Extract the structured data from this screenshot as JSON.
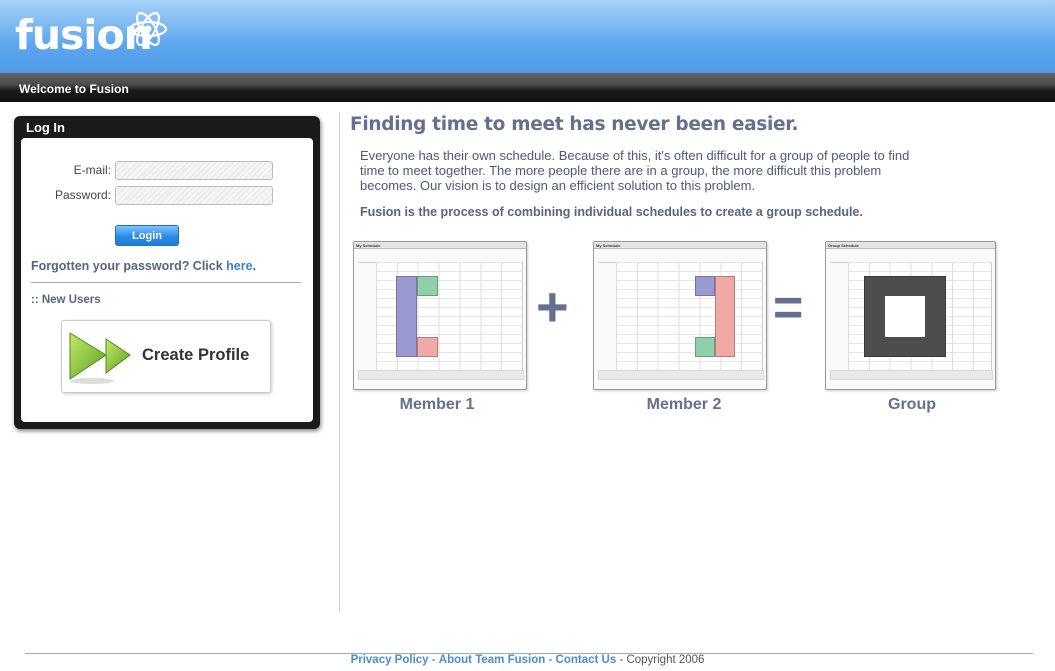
{
  "header": {
    "logo_text": "fusion",
    "welcome": "Welcome to Fusion"
  },
  "login": {
    "title": "Log In",
    "email_label": "E-mail:",
    "password_label": "Password:",
    "email_value": "",
    "password_value": "",
    "login_button": "Login",
    "forgot_prefix": "Forgotten your password? Click ",
    "forgot_link": "here",
    "forgot_suffix": ".",
    "new_users": ":: New Users",
    "create_profile": "Create Profile"
  },
  "main": {
    "headline": "Finding time to meet has never been easier.",
    "intro": "Everyone has their own schedule. Because of this, it's often difficult for a group of people to find time to meet together. The more people there are in a group, the more difficult this problem becomes. Our vision is to design an efficient solution to this problem.",
    "tagline": "Fusion is the process of combining individual schedules to create a group schedule.",
    "plus": "+",
    "equals": "=",
    "calendars": [
      {
        "title": "My Schedule",
        "caption": "Member 1"
      },
      {
        "title": "My Schedule",
        "caption": "Member 2"
      },
      {
        "title": "Group Schedule",
        "caption": "Group"
      }
    ]
  },
  "colors": {
    "busy_purple": "#9b9ad0",
    "busy_green": "#8fd0a8",
    "busy_red": "#f0a9a6",
    "group_busy": "#4d4d4d",
    "accent": "#656f8f"
  },
  "footer": {
    "privacy": "Privacy Policy",
    "sep1": " - ",
    "about": "About Team Fusion",
    "sep2": " - ",
    "contact": "Contact Us",
    "copyright": " - Copyright 2006"
  }
}
